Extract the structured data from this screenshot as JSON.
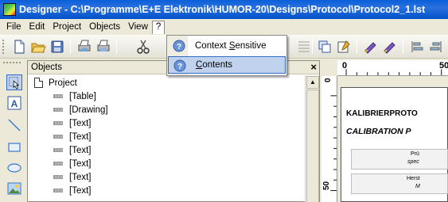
{
  "window": {
    "title": "Designer - C:\\Programme\\E+E Elektronik\\HUMOR-20\\Designs\\Protocol\\Protocol2_1.lst"
  },
  "menu": {
    "items": [
      {
        "label": "File"
      },
      {
        "label": "Edit"
      },
      {
        "label": "Project"
      },
      {
        "label": "Objects"
      },
      {
        "label": "View"
      },
      {
        "label": "?"
      }
    ]
  },
  "help_menu": {
    "items": [
      {
        "label_pre": "Context ",
        "label_u": "S",
        "label_post": "ensitive",
        "icon": "context-help-icon"
      },
      {
        "label_pre": "",
        "label_u": "C",
        "label_post": "ontents",
        "icon": "help-contents-icon",
        "highlighted": true
      }
    ]
  },
  "objects_panel": {
    "title": "Objects",
    "close_label": "×",
    "tree": {
      "root": "Project",
      "children": [
        "[Table]",
        "[Drawing]",
        "[Text]",
        "[Text]",
        "[Text]",
        "[Text]",
        "[Text]",
        "[Text]"
      ]
    }
  },
  "ruler": {
    "h_labels": [
      "0",
      "50"
    ],
    "v_labels": [
      "0",
      "50"
    ]
  },
  "page_preview": {
    "line1": "KALIBRIERPROTO",
    "line2": "CALIBRATION P",
    "box1_line1": "Prü",
    "box1_line2": "spec",
    "box2_line1": "Herst",
    "box2_line2": "M"
  },
  "colors": {
    "titlebar": "#0a5fd8",
    "menu_highlight": "#c1d2ee",
    "menu_highlight_border": "#316ac5",
    "chrome": "#ece9d8"
  }
}
